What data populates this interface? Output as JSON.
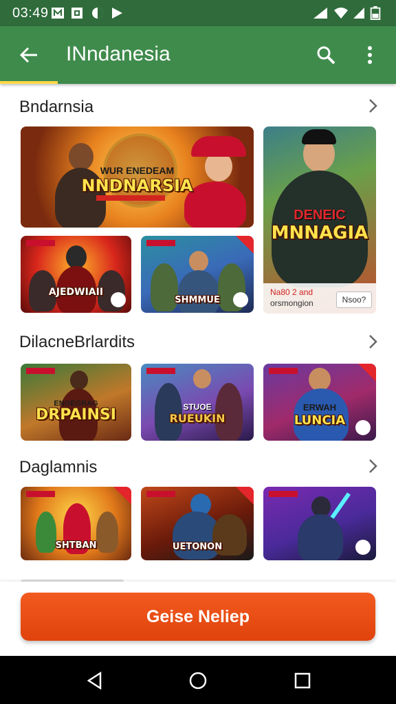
{
  "status_bar": {
    "time": "03:49"
  },
  "app_bar": {
    "title": "INndanesia"
  },
  "sections": [
    {
      "title": "Bndarnsia"
    },
    {
      "title": "DilacneBrlardits"
    },
    {
      "title": "Daglamnis"
    }
  ],
  "cards": {
    "s1_big": {
      "title": "NNDNARSIA",
      "sub": "WUR ENEDEAM"
    },
    "s1_tall": {
      "title": "MNNAGIA",
      "sub": "DENEIC",
      "caption1": "Na80 2 and",
      "caption2": "orsmongion",
      "badge": "Nsoo?"
    },
    "s1_small1": {
      "title": "AJEDWIAII"
    },
    "s1_small2": {
      "title": "SHMMUE"
    },
    "s2_1": {
      "title": "DRPAINSI",
      "sub": "ENGEGRAG"
    },
    "s2_2": {
      "title": "RUEUKIN",
      "sub": "STUOE"
    },
    "s2_3": {
      "title": "LUNCIA",
      "sub": "ERWAH"
    },
    "s3_1": {
      "title": "SHTBAN"
    },
    "s3_2": {
      "title": "UETONON"
    },
    "s3_3": {
      "title": ""
    }
  },
  "cta": {
    "label": "Geise Neliep"
  },
  "colors": {
    "status": "#2f6b3b",
    "appbar": "#3f8b4c",
    "accent": "#ffd84a",
    "cta": "#e9501a"
  }
}
